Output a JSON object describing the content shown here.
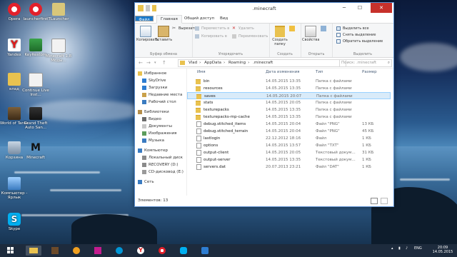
{
  "desktop_icons": [
    {
      "id": "opera",
      "label": "Opera"
    },
    {
      "id": "launcher",
      "label": "launcherfirst"
    },
    {
      "id": "tlauncher",
      "label": "TLauncher"
    },
    {
      "id": "yandex",
      "label": "Yandex"
    },
    {
      "id": "keyrestore",
      "label": "KeyRestore"
    },
    {
      "id": "html",
      "label": "Minecraft 1.8 Моды..."
    },
    {
      "id": "vlad",
      "label": "влад"
    },
    {
      "id": "continue",
      "label": "Continue Live Inst..."
    },
    {
      "id": "wot",
      "label": "World of Tanks"
    },
    {
      "id": "gta",
      "label": "Grand Theft Auto San..."
    },
    {
      "id": "trash",
      "label": "Корзина"
    },
    {
      "id": "minecraft",
      "label": "Minecraft"
    },
    {
      "id": "computer",
      "label": "Компьютер - Ярлык"
    },
    {
      "id": "skype",
      "label": "Skype"
    }
  ],
  "window": {
    "title": ".minecraft",
    "tabs": [
      "Файл",
      "Главная",
      "Общий доступ",
      "Вид"
    ],
    "ribbon": {
      "copy": "Копировать",
      "paste": "Вставить",
      "cut": "Вырезать",
      "copy_path": "Копировать путь",
      "paste_shortcut": "Вставить ярлык",
      "move_to": "Переместить в",
      "copy_to": "Копировать в",
      "delete": "Удалить",
      "rename": "Переименовать",
      "new_folder": "Создать папку",
      "new_item": "",
      "properties": "Свойства",
      "open": "Открыть",
      "select_all": "Выделить все",
      "deselect": "Снять выделение",
      "invert": "Обратить выделение",
      "group_clipboard": "Буфер обмена",
      "group_organize": "Упорядочить",
      "group_new": "Создать",
      "group_open": "Открыть",
      "group_select": "Выделить"
    },
    "address": {
      "crumbs": [
        "Vlad",
        "AppData",
        "Roaming",
        ".minecraft"
      ],
      "search_placeholder": "Поиск: .minecraft"
    },
    "nav": [
      {
        "label": "Избранное",
        "icon": "star-icon",
        "indent": 0
      },
      {
        "label": "SkyDrive",
        "icon": "cloud-icon",
        "indent": 1
      },
      {
        "label": "Загрузки",
        "icon": "download-icon",
        "indent": 1
      },
      {
        "label": "Недавние места",
        "icon": "recent-icon",
        "indent": 1
      },
      {
        "label": "Рабочий стол",
        "icon": "desktop-icon",
        "indent": 1
      },
      {
        "label": "Библиотеки",
        "icon": "library-icon",
        "indent": 0
      },
      {
        "label": "Видео",
        "icon": "video-icon",
        "indent": 1
      },
      {
        "label": "Документы",
        "icon": "document-icon",
        "indent": 1
      },
      {
        "label": "Изображения",
        "icon": "image-icon",
        "indent": 1
      },
      {
        "label": "Музыка",
        "icon": "music-icon",
        "indent": 1
      },
      {
        "label": "Компьютер",
        "icon": "computer-icon",
        "indent": 0
      },
      {
        "label": "Локальный диск",
        "icon": "drive-icon",
        "indent": 1
      },
      {
        "label": "RECOVERY (D:)",
        "icon": "drive-icon",
        "indent": 1
      },
      {
        "label": "CD-дисковод (E:)",
        "icon": "cd-icon",
        "indent": 1
      },
      {
        "label": "Сеть",
        "icon": "network-icon",
        "indent": 0
      }
    ],
    "columns": {
      "name": "Имя",
      "date": "Дата изменения",
      "type": "Тип",
      "size": "Размер"
    },
    "files": [
      {
        "name": "bin",
        "date": "14.05.2015 13:35",
        "type": "Папка с файлами",
        "size": "",
        "kind": "folder"
      },
      {
        "name": "resources",
        "date": "14.05.2015 13:35",
        "type": "Папка с файлами",
        "size": "",
        "kind": "folder"
      },
      {
        "name": "saves",
        "date": "14.05.2015 20:07",
        "type": "Папка с файлами",
        "size": "",
        "kind": "folder",
        "selected": true
      },
      {
        "name": "stats",
        "date": "14.05.2015 20:05",
        "type": "Папка с файлами",
        "size": "",
        "kind": "folder"
      },
      {
        "name": "texturepacks",
        "date": "14.05.2015 13:35",
        "type": "Папка с файлами",
        "size": "",
        "kind": "folder"
      },
      {
        "name": "texturepacks-mp-cache",
        "date": "14.05.2015 13:35",
        "type": "Папка с файлами",
        "size": "",
        "kind": "folder"
      },
      {
        "name": "debug.stitched_items",
        "date": "14.05.2015 20:04",
        "type": "Файл \"PNG\"",
        "size": "13 КБ",
        "kind": "file"
      },
      {
        "name": "debug.stitched_terrain",
        "date": "14.05.2015 20:04",
        "type": "Файл \"PNG\"",
        "size": "45 КБ",
        "kind": "file"
      },
      {
        "name": "lastlogin",
        "date": "22.12.2012 18:16",
        "type": "Файл",
        "size": "1 КБ",
        "kind": "file"
      },
      {
        "name": "options",
        "date": "14.05.2015 13:57",
        "type": "Файл \"TXT\"",
        "size": "1 КБ",
        "kind": "file"
      },
      {
        "name": "output-client",
        "date": "14.05.2015 20:05",
        "type": "Текстовый докум...",
        "size": "31 КБ",
        "kind": "file"
      },
      {
        "name": "output-server",
        "date": "14.05.2015 13:35",
        "type": "Текстовый докум...",
        "size": "1 КБ",
        "kind": "file"
      },
      {
        "name": "servers.dat",
        "date": "20.07.2013 23:21",
        "type": "Файл \"DAT\"",
        "size": "1 КБ",
        "kind": "file"
      }
    ],
    "status": "Элементов: 13"
  },
  "taskbar": {
    "items": [
      "start-button",
      "explorer",
      "minecraft",
      "winamp",
      "store",
      "hp",
      "yandex",
      "opera",
      "skype",
      "other"
    ],
    "lang": "ENG",
    "time": "20:09",
    "date": "14.05.2015"
  }
}
